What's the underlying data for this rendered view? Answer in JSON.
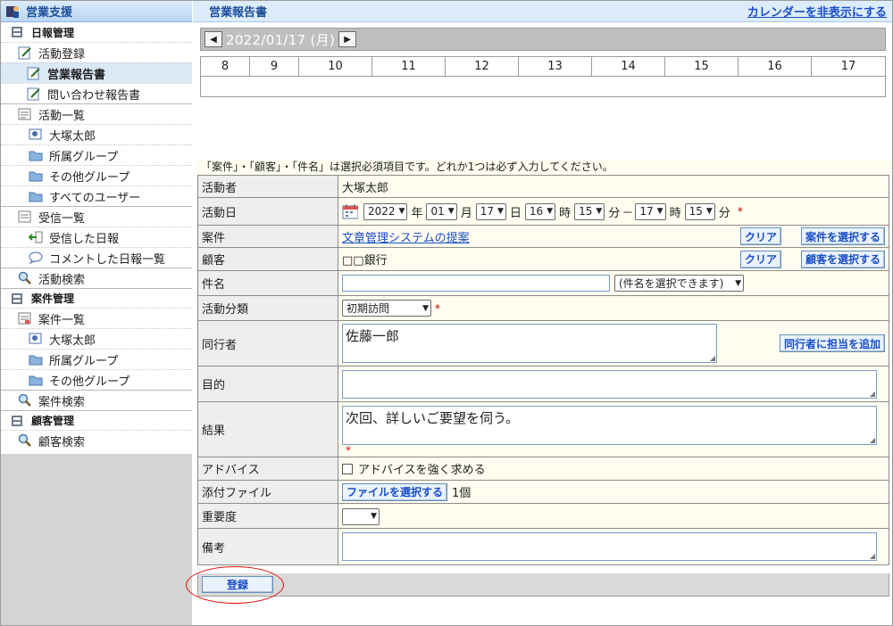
{
  "sidebar": {
    "header": "営業支援",
    "sections": {
      "nippo": "日報管理",
      "anken": "案件管理",
      "kokyaku": "顧客管理"
    },
    "items": {
      "katsudo_toroku": "活動登録",
      "eigyo_hokokusho": "営業報告書",
      "toiawase": "問い合わせ報告書",
      "katsudo_ichiran": "活動一覧",
      "otsuka1": "大塚太郎",
      "shozoku1": "所属グループ",
      "sonota1": "その他グループ",
      "subete": "すべてのユーザー",
      "jushin_ichiran": "受信一覧",
      "jushin_nippo": "受信した日報",
      "comment_nippo": "コメントした日報一覧",
      "katsudo_kensaku": "活動検索",
      "anken_ichiran": "案件一覧",
      "otsuka2": "大塚太郎",
      "shozoku2": "所属グループ",
      "sonota2": "その他グループ",
      "anken_kensaku": "案件検索",
      "kokyaku_kensaku": "顧客検索"
    }
  },
  "header": {
    "title": "営業報告書",
    "toggle_calendar": "カレンダーを非表示にする"
  },
  "date_bar": {
    "prev": "◀",
    "date": "2022/01/17 (月)",
    "next": "▶"
  },
  "timeline": {
    "hours": [
      "8",
      "9",
      "10",
      "11",
      "12",
      "13",
      "14",
      "15",
      "16",
      "17"
    ]
  },
  "notice": "「案件」・「顧客」・「件名」は選択必須項目です。どれか1つは必ず入力してください。",
  "form": {
    "actor": {
      "label": "活動者",
      "value": "大塚太郎"
    },
    "date": {
      "label": "活動日",
      "year": "2022",
      "year_unit": "年",
      "month": "01",
      "month_unit": "月",
      "day": "17",
      "day_unit": "日",
      "start_hour": "16",
      "hour_unit": "時",
      "start_min": "15",
      "min_unit": "分",
      "dash": "－",
      "end_hour": "17",
      "end_hour_unit": "時",
      "end_min": "15",
      "end_min_unit": "分",
      "required": "*"
    },
    "anken": {
      "label": "案件",
      "value": "文章管理システムの提案",
      "clear": "クリア",
      "select": "案件を選択する"
    },
    "kokyaku": {
      "label": "顧客",
      "value": "□□銀行",
      "clear": "クリア",
      "select": "顧客を選択する"
    },
    "subject": {
      "label": "件名",
      "value": "",
      "select": "(件名を選択できます)"
    },
    "category": {
      "label": "活動分類",
      "value": "初期訪問",
      "required": "*"
    },
    "companion": {
      "label": "同行者",
      "value": "佐藤一郎",
      "add": "同行者に担当を追加"
    },
    "purpose": {
      "label": "目的",
      "value": ""
    },
    "result": {
      "label": "結果",
      "value": "次回、詳しいご要望を伺う。",
      "required": "*"
    },
    "advice": {
      "label": "アドバイス",
      "checkbox": "アドバイスを強く求める",
      "checked": false
    },
    "attachment": {
      "label": "添付ファイル",
      "button": "ファイルを選択する",
      "count": "1個"
    },
    "importance": {
      "label": "重要度",
      "value": ""
    },
    "notes": {
      "label": "備考",
      "value": ""
    }
  },
  "footer": {
    "submit": "登録"
  },
  "colors": {
    "accent": "#1d4f9a",
    "link": "#1a4ec9",
    "required": "#d00000",
    "highlight_circle": "#e01010"
  },
  "icons": {
    "header": "sales-support-icon",
    "section": "cabinet-icon",
    "entry": "pencil-note-icon",
    "list": "list-icon",
    "user": "user-card-icon",
    "folder": "folder-icon",
    "received": "arrow-in-icon",
    "comment": "speech-bubble-icon",
    "search": "magnifier-icon",
    "calendar": "calendar-icon"
  }
}
